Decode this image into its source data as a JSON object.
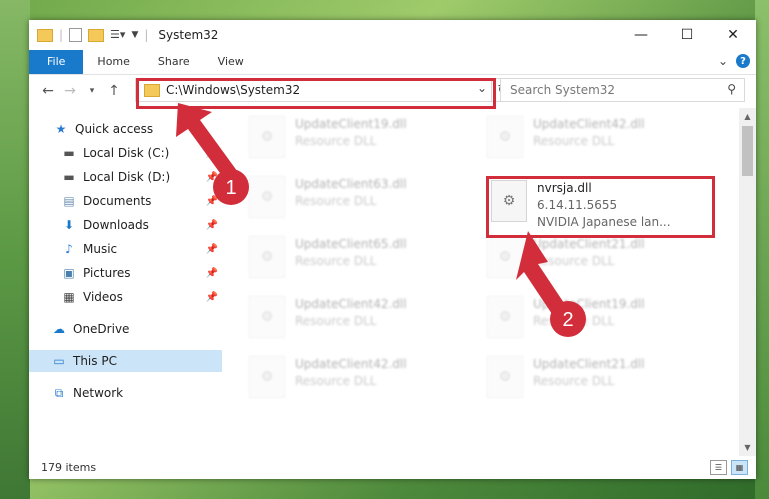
{
  "title_bar": {
    "title": "System32",
    "minimize": "—",
    "maximize": "☐",
    "close": "✕"
  },
  "ribbon": {
    "tabs": [
      "File",
      "Home",
      "Share",
      "View"
    ],
    "help": "?",
    "expand": "⌄"
  },
  "address": {
    "path": "C:\\Windows\\System32"
  },
  "search": {
    "placeholder": "Search System32"
  },
  "sidebar": {
    "items": [
      {
        "label": "Quick access",
        "icon": "star-icon"
      },
      {
        "label": "Local Disk (C:)",
        "icon": "drive-icon"
      },
      {
        "label": "Local Disk (D:)",
        "icon": "drive-icon"
      },
      {
        "label": "Documents",
        "icon": "documents-icon"
      },
      {
        "label": "Downloads",
        "icon": "downloads-icon"
      },
      {
        "label": "Music",
        "icon": "music-icon"
      },
      {
        "label": "Pictures",
        "icon": "pictures-icon"
      },
      {
        "label": "Videos",
        "icon": "videos-icon"
      },
      {
        "label": "OneDrive",
        "icon": "cloud-icon"
      },
      {
        "label": "This PC",
        "icon": "computer-icon"
      },
      {
        "label": "Network",
        "icon": "network-icon"
      }
    ]
  },
  "files": {
    "left": [
      {
        "name": "UpdateClient19.dll",
        "sub": "Resource DLL"
      },
      {
        "name": "UpdateClient63.dll",
        "sub": "Resource DLL"
      },
      {
        "name": "UpdateClient65.dll",
        "sub": "Resource DLL"
      },
      {
        "name": "UpdateClient42.dll",
        "sub": "Resource DLL"
      },
      {
        "name": "UpdateClient42.dll",
        "sub": "Resource DLL"
      }
    ],
    "right": [
      {
        "name": "UpdateClient42.dll",
        "sub": "Resource DLL"
      },
      {
        "name": "UpdateClient21.dll",
        "sub": "Resource DLL"
      },
      {
        "name": "UpdateClient19.dll",
        "sub": "Resource DLL"
      },
      {
        "name": "UpdateClient21.dll",
        "sub": "Resource DLL"
      }
    ],
    "highlighted": {
      "name": "nvrsja.dll",
      "version": "6.14.11.5655",
      "description": "NVIDIA Japanese lan..."
    }
  },
  "annotations": {
    "step1": "1",
    "step2": "2"
  },
  "status": {
    "count": "179 items"
  },
  "colors": {
    "accent": "#1979ca",
    "highlight": "#d12d3b"
  }
}
